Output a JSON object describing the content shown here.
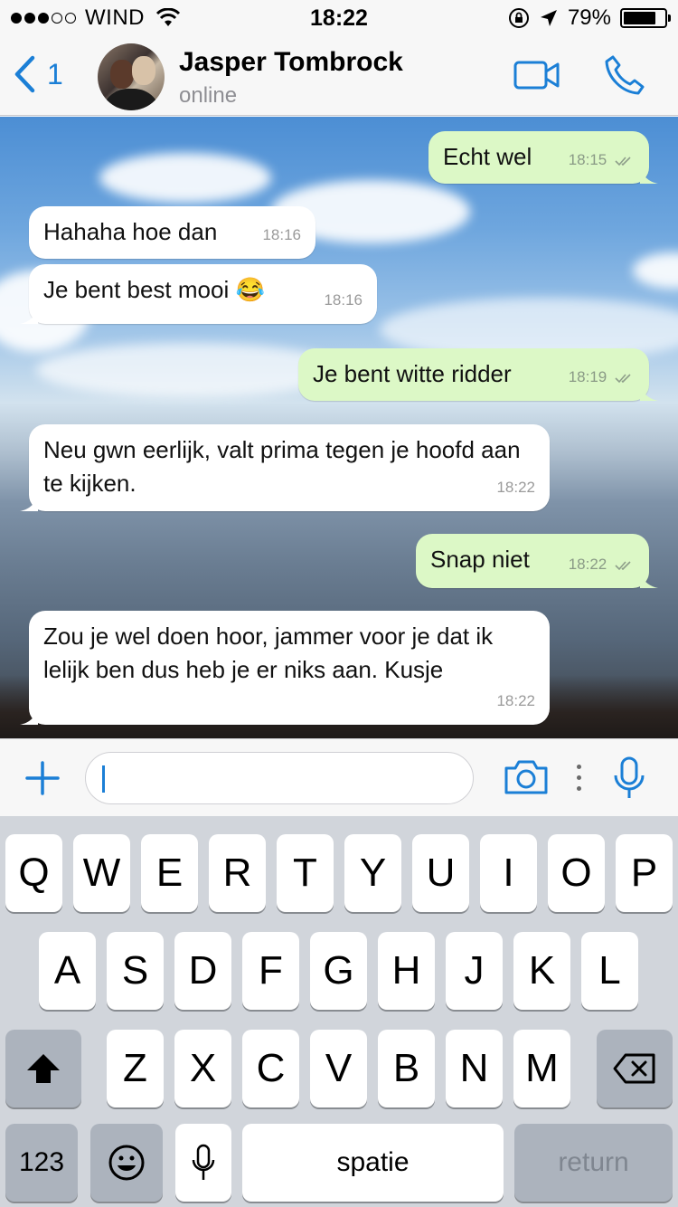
{
  "status_bar": {
    "carrier": "WIND",
    "time": "18:22",
    "battery": "79%",
    "battery_level": 0.79,
    "signal_bars_filled": 3,
    "signal_bars_total": 5
  },
  "header": {
    "back_count": "1",
    "contact_name": "Jasper Tombrock",
    "contact_status": "online",
    "accent_color": "#1b7fd6"
  },
  "messages": [
    {
      "direction": "out",
      "text": "Echt wel",
      "time": "18:15",
      "read": true
    },
    {
      "direction": "in",
      "text": "Hahaha hoe dan",
      "time": "18:16"
    },
    {
      "direction": "in",
      "text": "Je bent best mooi 😂",
      "time": "18:16"
    },
    {
      "direction": "out",
      "text": "Je bent witte ridder",
      "time": "18:19",
      "read": true
    },
    {
      "direction": "in",
      "text": "Neu gwn eerlijk, valt prima tegen je hoofd aan te kijken.",
      "time": "18:22"
    },
    {
      "direction": "out",
      "text": "Snap niet",
      "time": "18:22",
      "read": true
    },
    {
      "direction": "in",
      "text": "Zou je wel doen hoor, jammer voor je dat ik lelijk ben dus heb je er niks aan. Kusje",
      "time": "18:22"
    }
  ],
  "input": {
    "value": "",
    "icons": [
      "plus-icon",
      "camera-icon",
      "more-icon",
      "microphone-icon"
    ]
  },
  "keyboard": {
    "row1": [
      "Q",
      "W",
      "E",
      "R",
      "T",
      "Y",
      "U",
      "I",
      "O",
      "P"
    ],
    "row2": [
      "A",
      "S",
      "D",
      "F",
      "G",
      "H",
      "J",
      "K",
      "L"
    ],
    "row3": [
      "Z",
      "X",
      "C",
      "V",
      "B",
      "N",
      "M"
    ],
    "numbers_label": "123",
    "space_label": "spatie",
    "return_label": "return"
  }
}
